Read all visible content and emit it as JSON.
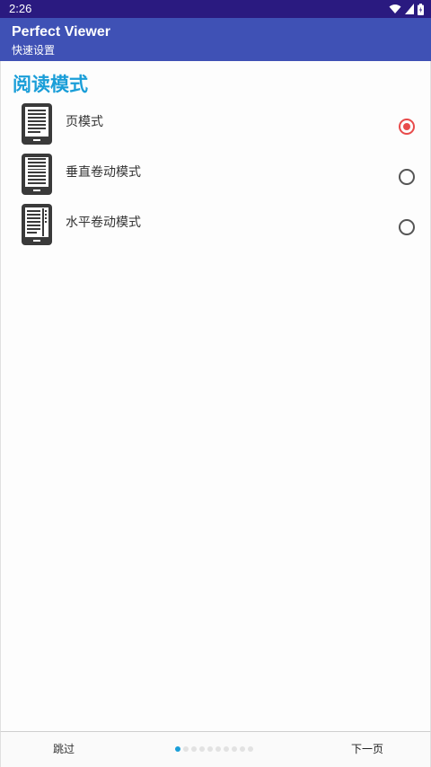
{
  "status_bar": {
    "time": "2:26",
    "icons": [
      "wifi-icon",
      "signal-icon",
      "battery-icon"
    ]
  },
  "app_bar": {
    "title": "Perfect Viewer",
    "subtitle": "快速设置"
  },
  "section": {
    "title": "阅读模式"
  },
  "options": [
    {
      "label": "页模式",
      "icon": "page-mode-icon",
      "selected": true
    },
    {
      "label": "垂直卷动模式",
      "icon": "vertical-scroll-icon",
      "selected": false
    },
    {
      "label": "水平卷动模式",
      "icon": "horizontal-scroll-icon",
      "selected": false
    }
  ],
  "bottom_bar": {
    "skip_label": "跳过",
    "next_label": "下一页",
    "page_count": 10,
    "current_page": 1
  },
  "colors": {
    "status_bar": "#2a1a80",
    "app_bar": "#3f51b5",
    "accent": "#1a9ed8",
    "radio_selected": "#e84b4b"
  }
}
